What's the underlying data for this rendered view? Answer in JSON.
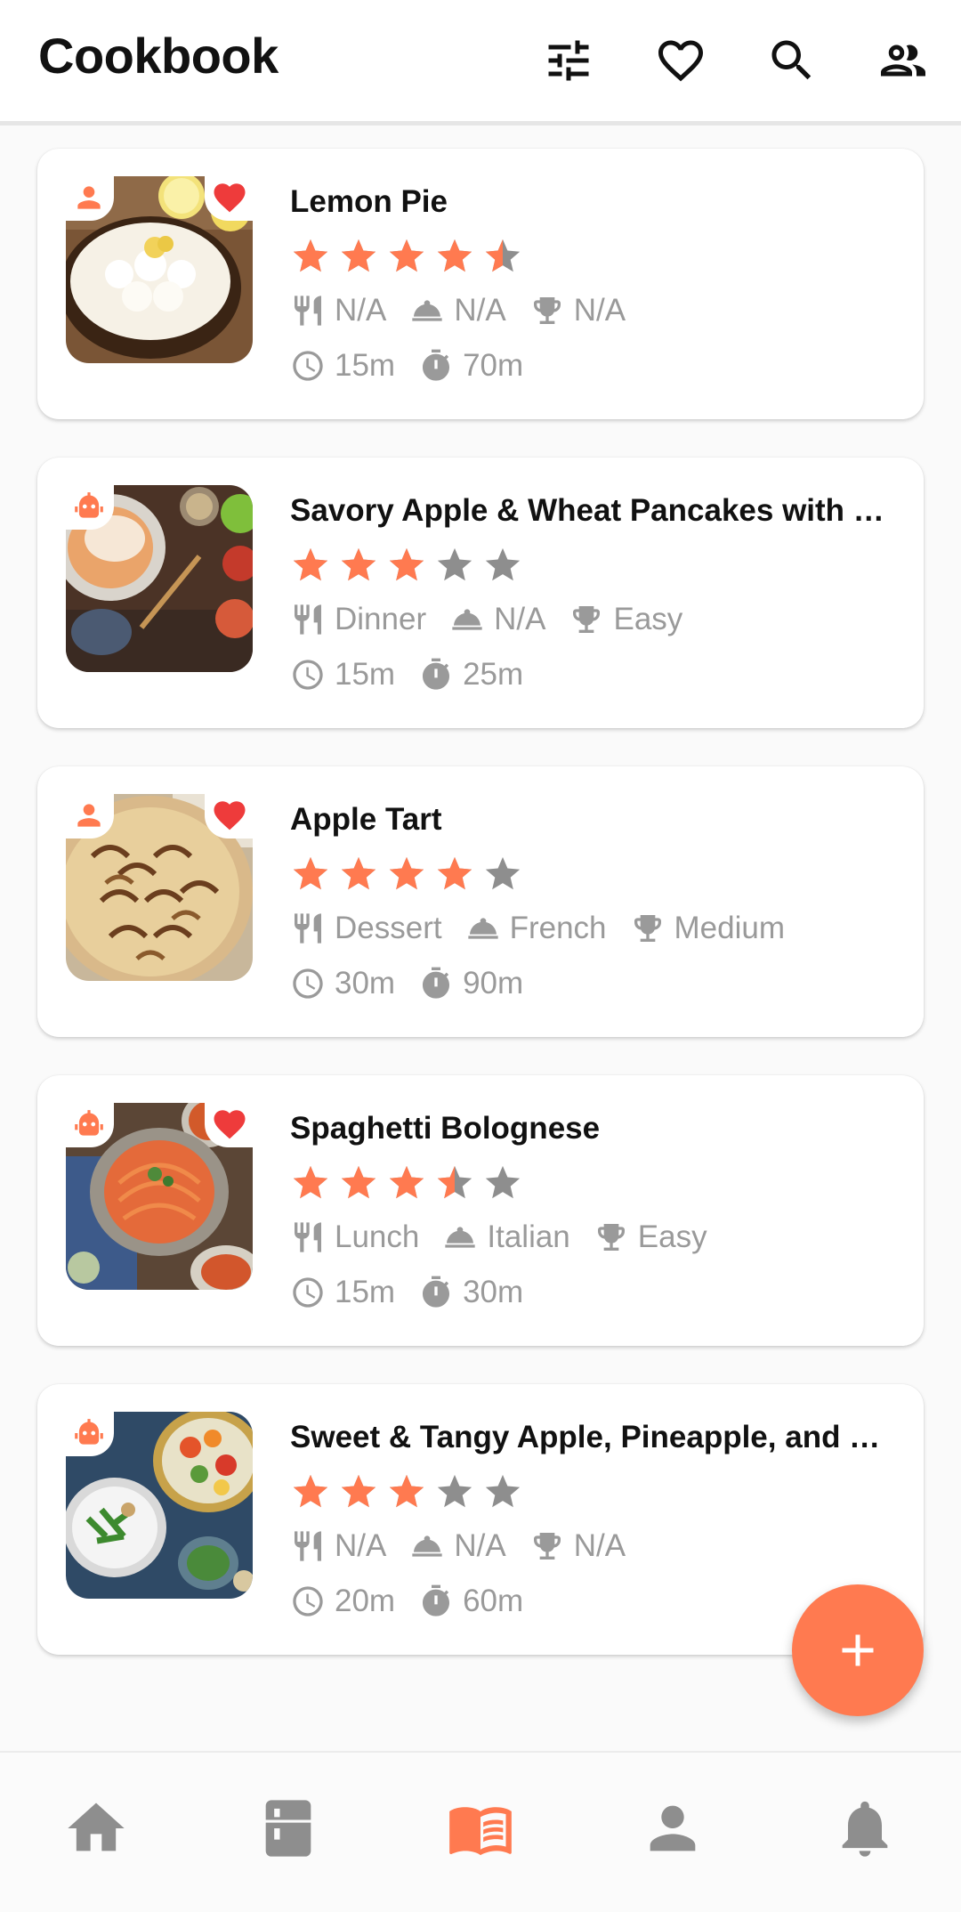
{
  "app": {
    "title": "Cookbook",
    "accent_color": "#ff7a50",
    "favorite_color": "#ee3b3b",
    "inactive_color": "#8e8e8e"
  },
  "appbar": {
    "actions": [
      {
        "icon": "filter-sliders-icon"
      },
      {
        "icon": "heart-outline-icon"
      },
      {
        "icon": "search-icon"
      },
      {
        "icon": "people-icon"
      }
    ]
  },
  "recipes": [
    {
      "title": "Lemon Pie",
      "rating": 4.5,
      "source_icon": "person-icon",
      "favorite": true,
      "meal": "N/A",
      "cuisine": "N/A",
      "difficulty": "N/A",
      "prep_time": "15m",
      "cook_time": "70m"
    },
    {
      "title": "Savory Apple & Wheat Pancakes with …",
      "rating": 3,
      "source_icon": "robot-icon",
      "favorite": false,
      "meal": "Dinner",
      "cuisine": "N/A",
      "difficulty": "Easy",
      "prep_time": "15m",
      "cook_time": "25m"
    },
    {
      "title": "Apple Tart",
      "rating": 4,
      "source_icon": "person-icon",
      "favorite": true,
      "meal": "Dessert",
      "cuisine": "French",
      "difficulty": "Medium",
      "prep_time": "30m",
      "cook_time": "90m"
    },
    {
      "title": "Spaghetti Bolognese",
      "rating": 3.5,
      "source_icon": "robot-icon",
      "favorite": true,
      "meal": "Lunch",
      "cuisine": "Italian",
      "difficulty": "Easy",
      "prep_time": "15m",
      "cook_time": "30m"
    },
    {
      "title": "Sweet & Tangy Apple, Pineapple, and …",
      "rating": 3,
      "source_icon": "robot-icon",
      "favorite": false,
      "meal": "N/A",
      "cuisine": "N/A",
      "difficulty": "N/A",
      "prep_time": "20m",
      "cook_time": "60m"
    }
  ],
  "fab": {
    "icon": "plus-icon"
  },
  "bottom_nav": {
    "active_index": 2,
    "items": [
      {
        "icon": "home-icon"
      },
      {
        "icon": "fridge-icon"
      },
      {
        "icon": "open-book-icon"
      },
      {
        "icon": "profile-icon"
      },
      {
        "icon": "bell-icon"
      }
    ]
  }
}
